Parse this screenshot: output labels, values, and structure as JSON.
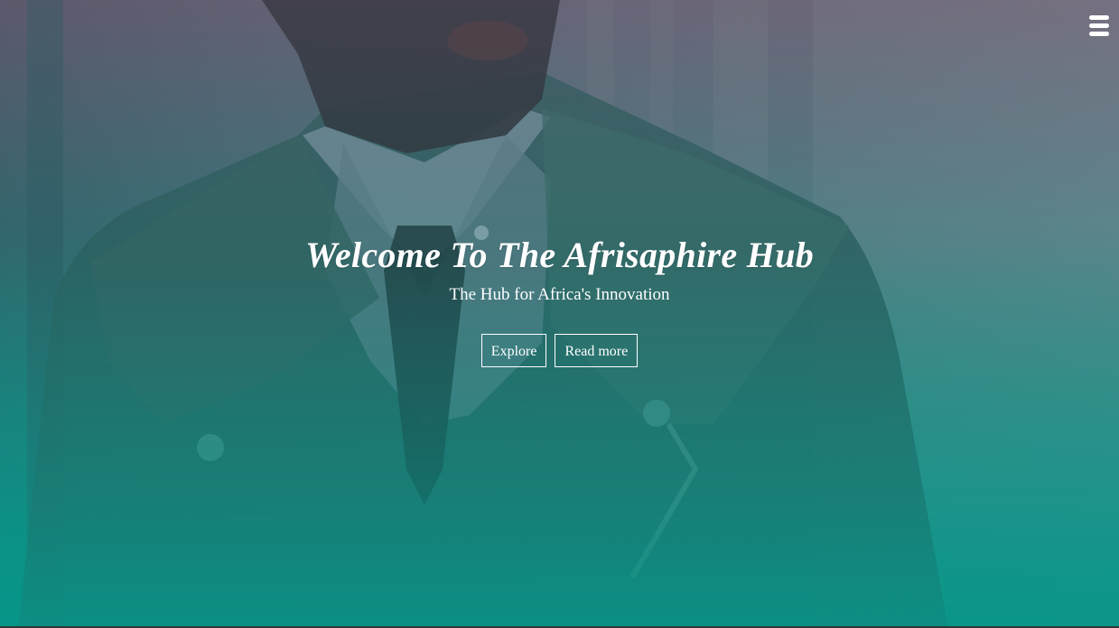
{
  "hero": {
    "title": "Welcome To The Afrisaphire Hub",
    "subtitle": "The Hub for Africa's Innovation",
    "buttons": [
      {
        "label": "Explore"
      },
      {
        "label": "Read more"
      }
    ],
    "background_image": "man-in-trench-coat-photo",
    "overlay_colors": {
      "top": "#6a5a72",
      "bottom": "#06968a"
    }
  },
  "nav": {
    "menu_icon": "hamburger-menu-icon"
  }
}
